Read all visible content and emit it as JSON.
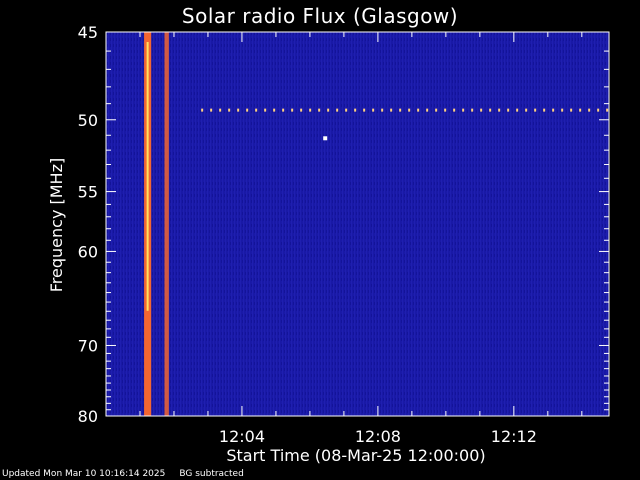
{
  "chart_data": {
    "type": "heatmap",
    "title": "Solar radio Flux (Glasgow)",
    "xlabel": "Start Time (08-Mar-25 12:00:00)",
    "ylabel": "Frequency [MHz]",
    "x_ticks": [
      {
        "label": "12:04",
        "minutes": 4
      },
      {
        "label": "12:08",
        "minutes": 8
      },
      {
        "label": "12:12",
        "minutes": 12
      }
    ],
    "xlim_minutes": [
      0,
      14.8
    ],
    "y_ticks": [
      45,
      50,
      55,
      60,
      70,
      80
    ],
    "ylim": [
      45,
      80
    ],
    "yscale": "reciprocal",
    "colors": {
      "background": "#1a1aa8",
      "burst": "#ff6a2a",
      "burst_core": "#ffe060",
      "axes": "#ffffff"
    },
    "bursts": [
      {
        "minutes_start": 1.15,
        "minutes_end": 1.3,
        "freq_from": 45,
        "freq_to": 80,
        "intensity": "high"
      },
      {
        "minutes_start": 1.75,
        "minutes_end": 1.82,
        "freq_from": 45,
        "freq_to": 80,
        "intensity": "medium"
      }
    ],
    "interference_line": {
      "freq": 49.4,
      "minutes_start": 2.8,
      "minutes_end": 14.8
    },
    "hot_pixel": {
      "freq": 51.2,
      "minutes": 6.45
    }
  },
  "footer": {
    "updated": "Updated Mon Mar 10 10:16:14 2025",
    "note": "BG subtracted"
  }
}
